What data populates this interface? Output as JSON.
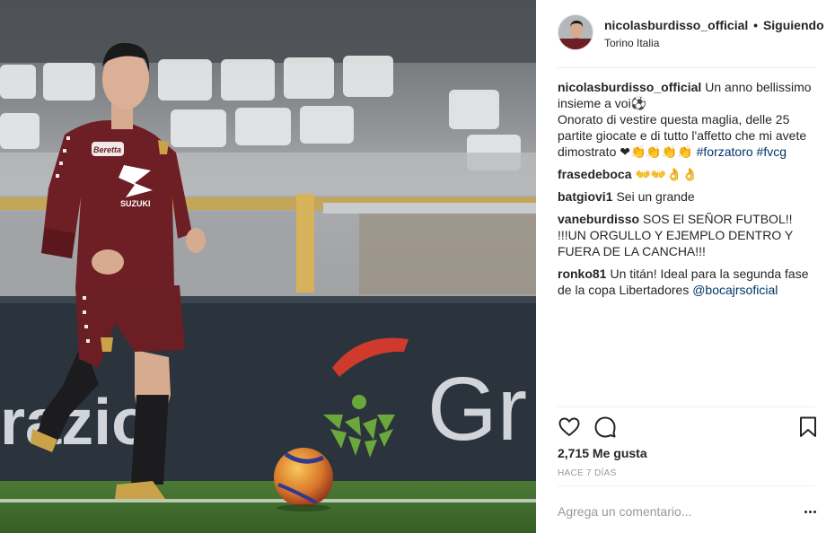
{
  "post": {
    "username": "nicolasburdisso_official",
    "separator": "•",
    "follow_status": "Siguiendo",
    "location": "Torino Italia",
    "caption": {
      "username": "nicolasburdisso_official",
      "line1": "Un anno bellissimo insieme a voi⚽",
      "line2": "Onorato di vestire questa maglia, delle 25 partite giocate e di tutto l'affetto che mi avete dimostrato ❤👏👏👏👏",
      "hashtag1": "#forzatoro",
      "hashtag2": "#fvcg"
    },
    "comments": [
      {
        "username": "frasedeboca",
        "text": "👐👐👌👌"
      },
      {
        "username": "batgiovi1",
        "text": "Sei un grande"
      },
      {
        "username": "vaneburdisso",
        "text": "SOS El SEÑOR FUTBOL!! !!!UN ORGULLO Y EJEMPLO DENTRO Y FUERA DE LA CANCHA!!!"
      },
      {
        "username": "ronko81",
        "text": "Un titán! Ideal para la segunda fase de la copa Libertadores",
        "mention": "@bocajrsoficial"
      }
    ],
    "likes": "2,715 Me gusta",
    "time_ago": "Hace 7 días",
    "comment_placeholder": "Agrega un comentario...",
    "icons": {
      "like": "heart-icon",
      "comment": "speech-bubble-icon",
      "save": "bookmark-icon",
      "more": "more-options-icon"
    }
  },
  "photo": {
    "jersey_sponsor": "SUZUKI",
    "chest_logo": "Beretta",
    "board_text_left": "razio",
    "board_text_right": "Gr",
    "colors": {
      "jersey": "#6b1e23",
      "pitch": "#3f6a2c",
      "board": "#2d3740",
      "seats": "#e9e9ea"
    }
  }
}
